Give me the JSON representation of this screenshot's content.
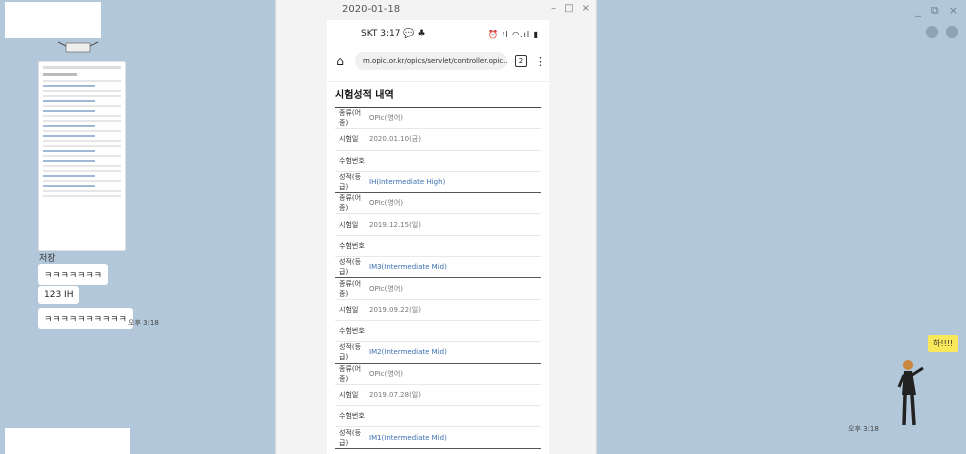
{
  "chat": {
    "controls": {
      "minimize": "_",
      "restore": "⧉",
      "close": "×"
    },
    "saved_label": "저장",
    "messages": [
      {
        "text": "ㅋㅋㅋㅋㅋㅋㅋ"
      },
      {
        "text": "123 IH"
      },
      {
        "text": "ㅋㅋㅋㅋㅋㅋㅋㅋㅋㅋ"
      }
    ],
    "left_time": "오후 3:18",
    "right_time": "오후 3:18",
    "sticker_text": "하!!!!"
  },
  "viewer": {
    "title": "2020-01-18",
    "controls": {
      "minimize": "–",
      "maximize": "□",
      "close": "×"
    }
  },
  "phone": {
    "carrier": "SKT 3:17",
    "carrier_icons": "💬 ♣",
    "status_icons": "⏰ ᵎl ◠.ıl ▮",
    "url": "m.opic.or.kr/opics/servlet/controller.opic...",
    "tab_count": "2",
    "page_title": "시험성적 내역",
    "labels": {
      "type": "종류(어종)",
      "date": "시험일",
      "exam_no": "수험번호",
      "grade": "성적(등급)"
    },
    "records": [
      {
        "type": "OPIc(영어)",
        "date": "2020.01.10(금)",
        "exam_no": "",
        "grade": "IH(Intermediate High)"
      },
      {
        "type": "OPIc(영어)",
        "date": "2019.12.15(일)",
        "exam_no": "",
        "grade": "IM3(Intermediate Mid)"
      },
      {
        "type": "OPIc(영어)",
        "date": "2019.09.22(일)",
        "exam_no": "",
        "grade": "IM2(Intermediate Mid)"
      },
      {
        "type": "OPIc(영어)",
        "date": "2019.07.28(일)",
        "exam_no": "",
        "grade": "IM1(Intermediate Mid)"
      }
    ]
  },
  "colors": {
    "chat_bg": "#b2c7da",
    "grade_link": "#3a6fb0",
    "sticker": "#f8e85a"
  }
}
